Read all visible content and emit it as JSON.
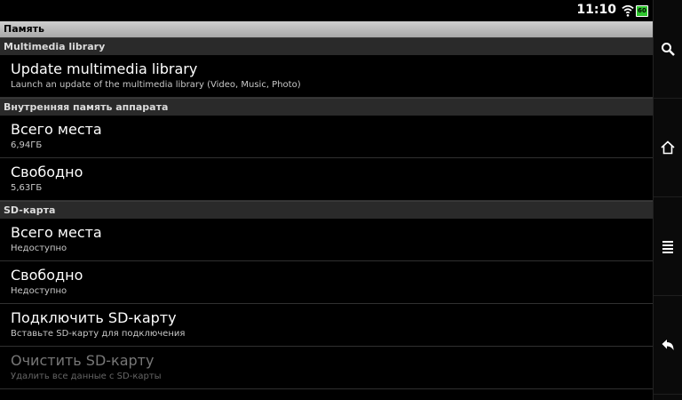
{
  "status": {
    "time": "11:10",
    "battery": "60"
  },
  "title": "Память",
  "sections": {
    "media": "Multimedia library",
    "internal": "Внутренняя память аппарата",
    "sd": "SD-карта"
  },
  "items": {
    "update_lib": {
      "title": "Update multimedia library",
      "summary": "Launch an update of the multimedia library (Video, Music, Photo)"
    },
    "int_total": {
      "title": "Всего места",
      "summary": "6,94ГБ"
    },
    "int_free": {
      "title": "Свободно",
      "summary": "5,63ГБ"
    },
    "sd_total": {
      "title": "Всего места",
      "summary": "Недоступно"
    },
    "sd_free": {
      "title": "Свободно",
      "summary": "Недоступно"
    },
    "sd_mount": {
      "title": "Подключить SD-карту",
      "summary": "Вставьте SD-карту для подключения"
    },
    "sd_format": {
      "title": "Очистить SD-карту",
      "summary": "Удалить все данные с SD-карты"
    }
  },
  "navbar": {
    "icons": [
      "search-icon",
      "home-icon",
      "menu-icon",
      "back-icon"
    ]
  }
}
